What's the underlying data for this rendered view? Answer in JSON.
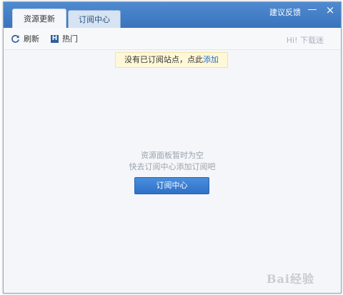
{
  "tabs": [
    {
      "label": "资源更新",
      "active": true
    },
    {
      "label": "订阅中心",
      "active": false
    }
  ],
  "header": {
    "feedback_label": "建议反馈",
    "minimize_glyph": "—",
    "close_glyph": "×"
  },
  "toolbar": {
    "refresh_label": "刷新",
    "refresh_icon": "refresh-icon",
    "hot_label": "热门",
    "hot_icon_glyph": "H",
    "status_text": "Hi! 下载迷"
  },
  "notice": {
    "text": "没有已订阅站点，点此",
    "link_label": "添加"
  },
  "empty_state": {
    "line1": "资源面板暂时为空",
    "line2": "快去订阅中心添加订阅吧",
    "button_label": "订阅中心"
  },
  "watermark": "Bai经验",
  "colors": {
    "titlebar": "#3a73bd",
    "accent": "#2f70c8",
    "notice_bg": "#fff8d8",
    "link": "#2a6fc9"
  }
}
